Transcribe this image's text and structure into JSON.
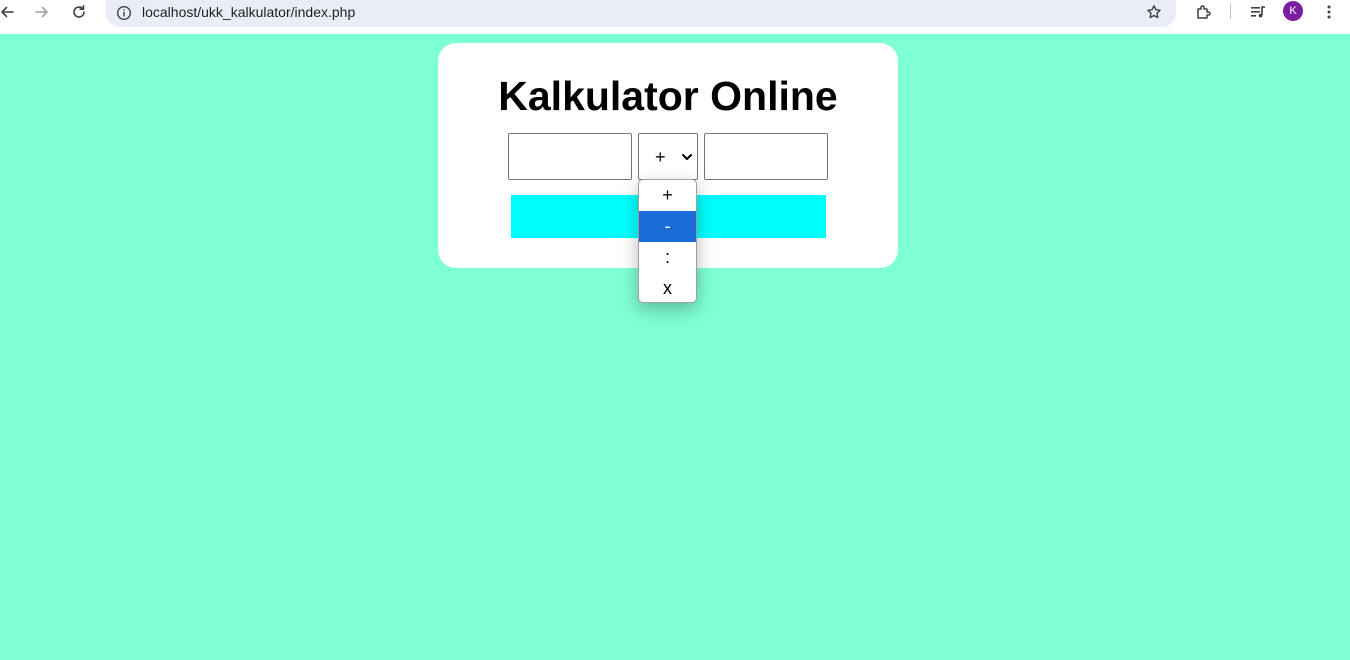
{
  "browser": {
    "url": "localhost/ukk_kalkulator/index.php",
    "profile_initial": "K",
    "icons": [
      "back-arrow-icon",
      "forward-arrow-icon",
      "reload-icon",
      "info-icon",
      "star-icon",
      "extensions-icon",
      "media-icon",
      "more-menu-icon"
    ]
  },
  "calculator": {
    "title": "Kalkulator Online",
    "first_number": "",
    "operator_selected": "+",
    "second_number": "",
    "operators": [
      "+",
      "-",
      ":",
      "x"
    ],
    "highlighted_option": "-"
  },
  "colors": {
    "page_background": "#7fffd4",
    "card_background": "#ffffff",
    "button_background": "#00ffff",
    "highlight": "#1a6bd6",
    "avatar": "#7b1fa2"
  }
}
